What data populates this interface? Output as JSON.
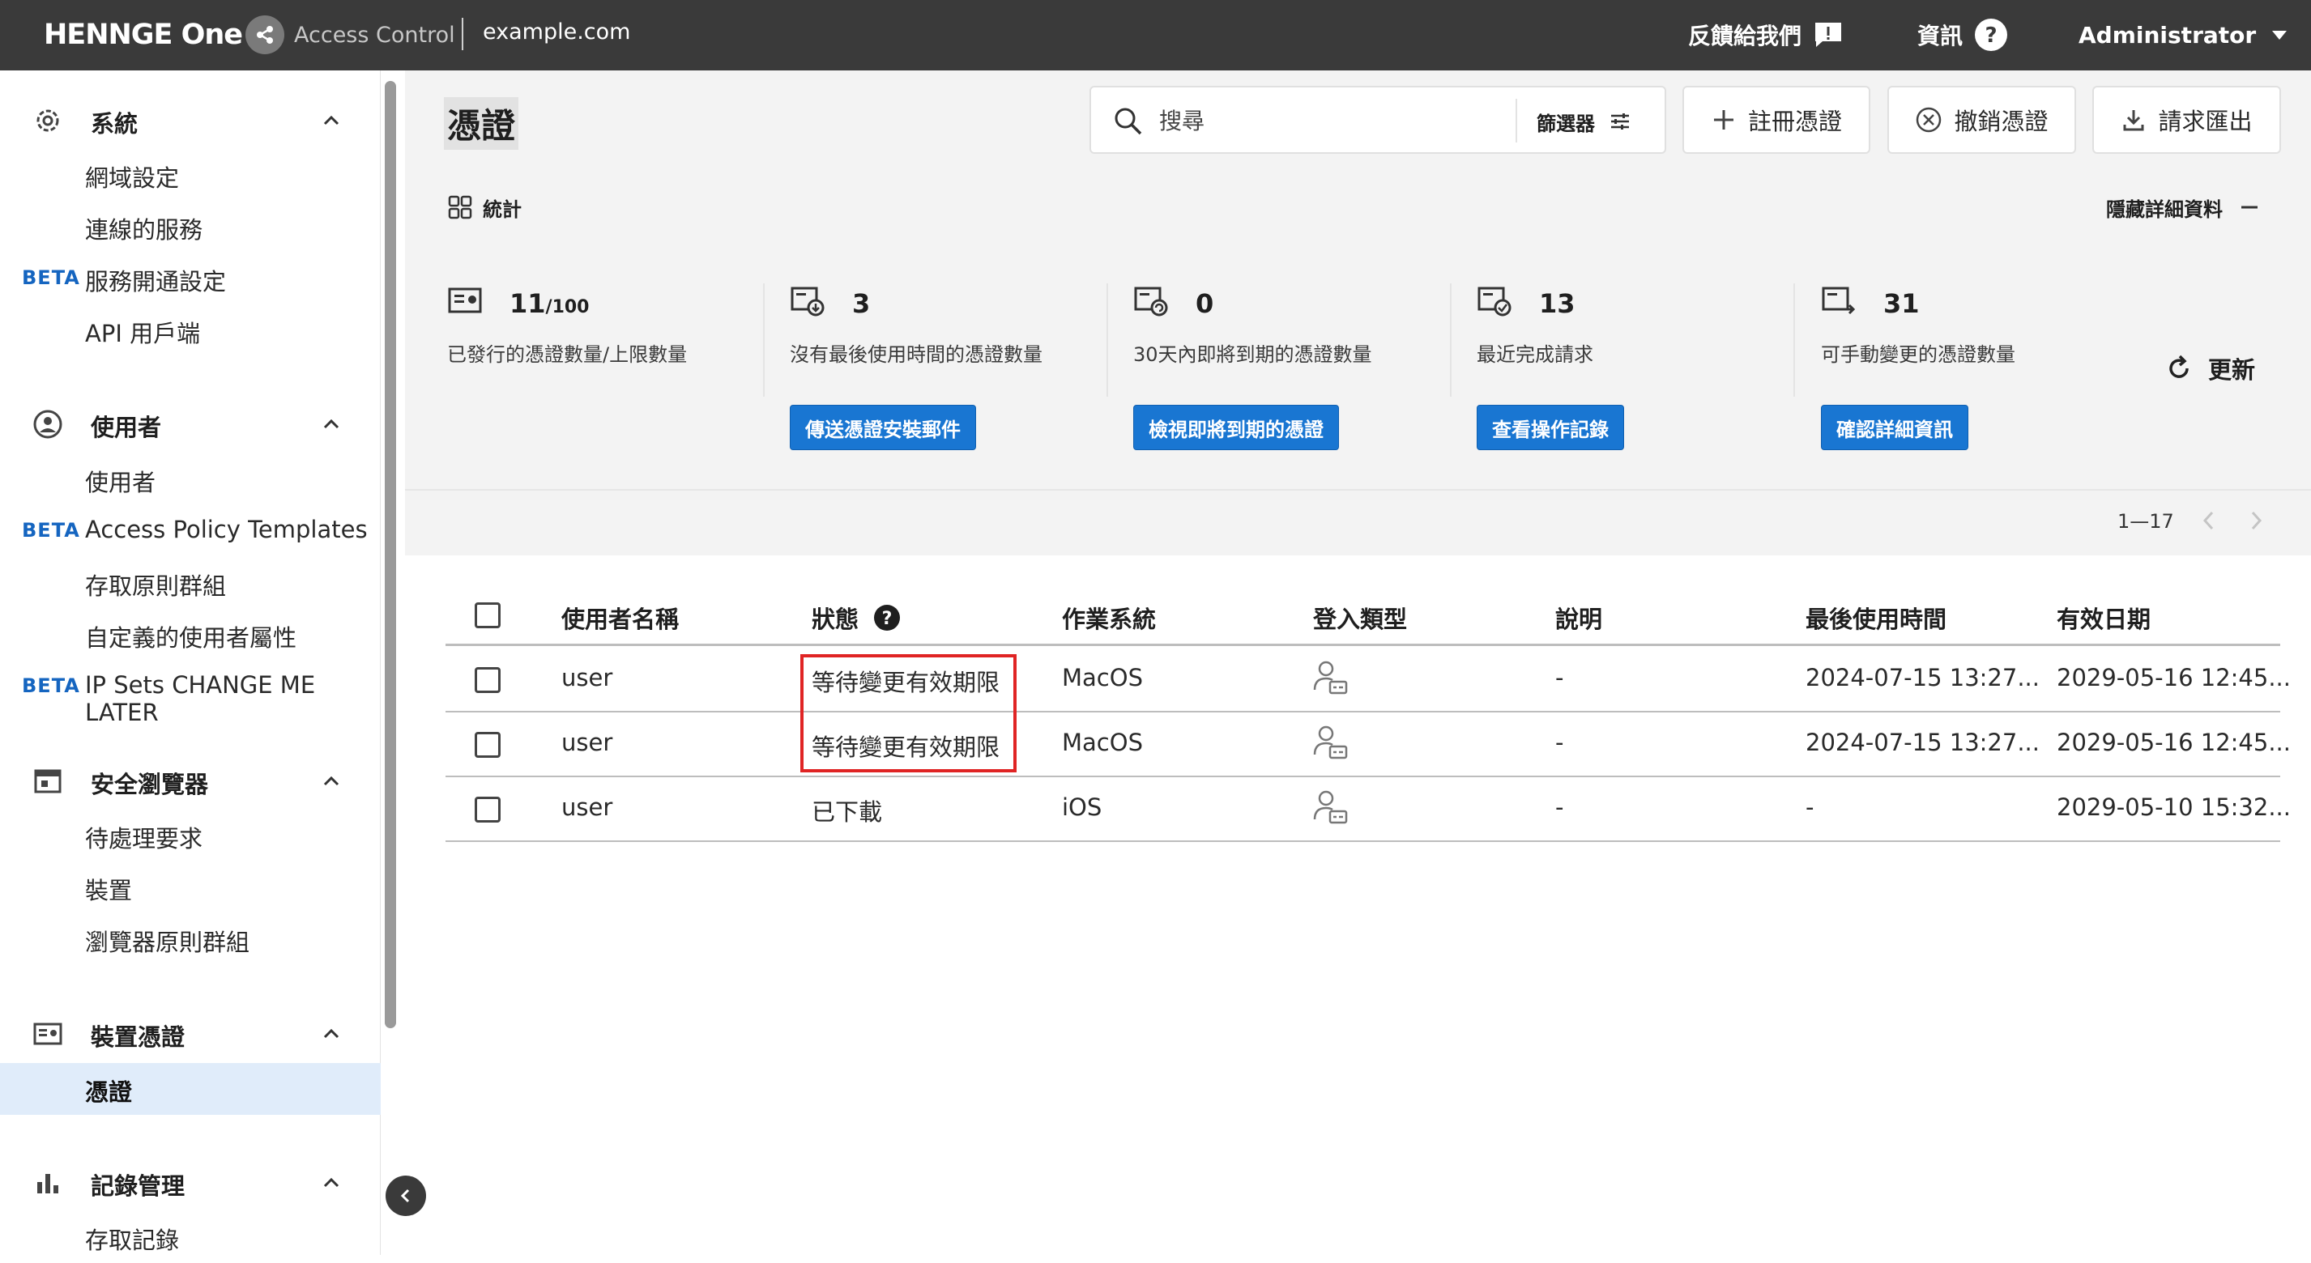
{
  "topbar": {
    "brand": "HENNGE One",
    "product": "Access Control",
    "domain": "example.com",
    "feedback": "反饋給我們",
    "info": "資訊",
    "user": "Administrator"
  },
  "sidebar": {
    "sections": [
      {
        "title": "系統",
        "icon": "gear-icon",
        "items": [
          {
            "label": "網域設定",
            "beta": ""
          },
          {
            "label": "連線的服務",
            "beta": ""
          },
          {
            "label": "服務開通設定",
            "beta": "BETA"
          },
          {
            "label": "API 用戶端",
            "beta": ""
          }
        ]
      },
      {
        "title": "使用者",
        "icon": "user-circle-icon",
        "items": [
          {
            "label": "使用者",
            "beta": ""
          },
          {
            "label": "Access Policy Templates",
            "beta": "BETA"
          },
          {
            "label": "存取原則群組",
            "beta": ""
          },
          {
            "label": "自定義的使用者屬性",
            "beta": ""
          },
          {
            "label": "IP Sets CHANGE ME LATER",
            "beta": "BETA"
          }
        ]
      },
      {
        "title": "安全瀏覽器",
        "icon": "browser-icon",
        "items": [
          {
            "label": "待處理要求",
            "beta": ""
          },
          {
            "label": "裝置",
            "beta": ""
          },
          {
            "label": "瀏覽器原則群組",
            "beta": ""
          }
        ]
      },
      {
        "title": "裝置憑證",
        "icon": "certificate-icon",
        "items": [
          {
            "label": "憑證",
            "beta": "",
            "active": true
          }
        ]
      },
      {
        "title": "記錄管理",
        "icon": "bar-chart-icon",
        "items": [
          {
            "label": "存取記錄",
            "beta": ""
          }
        ]
      }
    ]
  },
  "main": {
    "title": "憑證",
    "search_placeholder": "搜尋",
    "filter_label": "篩選器",
    "actions": {
      "register": "註冊憑證",
      "revoke": "撤銷憑證",
      "export": "請求匯出"
    },
    "stats_label": "統計",
    "hide_details": "隱藏詳細資料",
    "refresh": "更新",
    "stats": [
      {
        "value": "11",
        "suffix": "/100",
        "desc": "已發行的憑證數量/上限數量",
        "button": ""
      },
      {
        "value": "3",
        "suffix": "",
        "desc": "沒有最後使用時間的憑證數量",
        "button": "傳送憑證安裝郵件"
      },
      {
        "value": "0",
        "suffix": "",
        "desc": "30天內即將到期的憑證數量",
        "button": "檢視即將到期的憑證"
      },
      {
        "value": "13",
        "suffix": "",
        "desc": "最近完成請求",
        "button": "查看操作記錄"
      },
      {
        "value": "31",
        "suffix": "",
        "desc": "可手動變更的憑證數量",
        "button": "確認詳細資訊"
      }
    ],
    "pager": "1—17"
  },
  "table": {
    "headers": [
      "使用者名稱",
      "狀態",
      "作業系統",
      "登入類型",
      "說明",
      "最後使用時間",
      "有效日期"
    ],
    "rows": [
      {
        "user": "user",
        "status": "等待變更有效期限",
        "os": "MacOS",
        "desc": "-",
        "last_used": "2024-07-15 13:27...",
        "expiry": "2029-05-16 12:45..."
      },
      {
        "user": "user",
        "status": "等待變更有效期限",
        "os": "MacOS",
        "desc": "-",
        "last_used": "2024-07-15 13:27...",
        "expiry": "2029-05-16 12:45..."
      },
      {
        "user": "user",
        "status": "已下載",
        "os": "iOS",
        "desc": "-",
        "last_used": "-",
        "expiry": "2029-05-10 15:32..."
      }
    ]
  },
  "colors": {
    "topbar": "#3a3a3a",
    "accent": "#1976d2",
    "beta": "#1565c0",
    "highlight": "#e02424",
    "active_nav": "#e0ecfa"
  }
}
